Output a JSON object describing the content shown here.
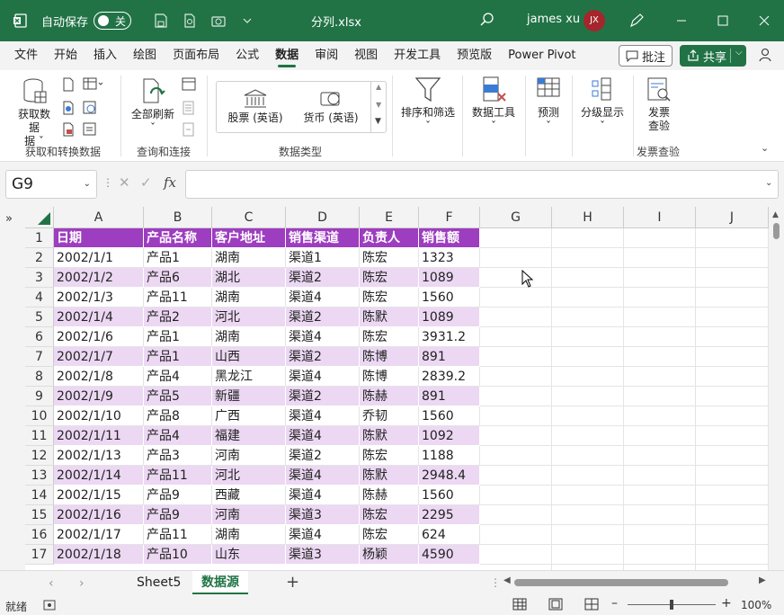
{
  "title_bar": {
    "autosave_label": "自动保存",
    "autosave_state": "关",
    "doc_title": "分列.xlsx",
    "user_name": "james xu",
    "user_initials": "JX"
  },
  "menu": {
    "items": [
      "文件",
      "开始",
      "插入",
      "绘图",
      "页面布局",
      "公式",
      "数据",
      "审阅",
      "视图",
      "开发工具",
      "预览版",
      "Power Pivot"
    ],
    "active": "数据",
    "comment_label": "批注",
    "share_label": "共享"
  },
  "ribbon": {
    "get_data": "获取数据",
    "get_data_sub": "据",
    "group_get": "获取和转换数据",
    "refresh_all": "全部刷新",
    "group_query": "查询和连接",
    "stocks": "股票 (英语)",
    "currency": "货币 (英语)",
    "group_types": "数据类型",
    "sort_filter": "排序和筛选",
    "data_tools": "数据工具",
    "forecast": "预测",
    "outline": "分级显示",
    "invoice_check": "发票",
    "invoice_check_2": "查验",
    "group_invoice": "发票查验"
  },
  "formula_bar": {
    "name_box": "G9",
    "fx": "fx",
    "formula": ""
  },
  "sheet": {
    "columns": [
      "A",
      "B",
      "C",
      "D",
      "E",
      "F",
      "G",
      "H",
      "I",
      "J"
    ],
    "row_numbers": [
      "1",
      "2",
      "3",
      "4",
      "5",
      "6",
      "7",
      "8",
      "9",
      "10",
      "11",
      "12",
      "13",
      "14",
      "15",
      "16",
      "17"
    ],
    "header": [
      "日期",
      "产品名称",
      "客户地址",
      "销售渠道",
      "负责人",
      "销售额"
    ],
    "rows": [
      [
        "2002/1/1",
        "产品1",
        "湖南",
        "渠道1",
        "陈宏",
        "1323"
      ],
      [
        "2002/1/2",
        "产品6",
        "湖北",
        "渠道2",
        "陈宏",
        "1089"
      ],
      [
        "2002/1/3",
        "产品11",
        "湖南",
        "渠道4",
        "陈宏",
        "1560"
      ],
      [
        "2002/1/4",
        "产品2",
        "河北",
        "渠道2",
        "陈默",
        "1089"
      ],
      [
        "2002/1/6",
        "产品1",
        "湖南",
        "渠道4",
        "陈宏",
        "3931.2"
      ],
      [
        "2002/1/7",
        "产品1",
        "山西",
        "渠道2",
        "陈博",
        "891"
      ],
      [
        "2002/1/8",
        "产品4",
        "黑龙江",
        "渠道4",
        "陈博",
        "2839.2"
      ],
      [
        "2002/1/9",
        "产品5",
        "新疆",
        "渠道2",
        "陈赫",
        "891"
      ],
      [
        "2002/1/10",
        "产品8",
        "广西",
        "渠道4",
        "乔韧",
        "1560"
      ],
      [
        "2002/1/11",
        "产品4",
        "福建",
        "渠道4",
        "陈默",
        "1092"
      ],
      [
        "2002/1/13",
        "产品3",
        "河南",
        "渠道2",
        "陈宏",
        "1188"
      ],
      [
        "2002/1/14",
        "产品11",
        "河北",
        "渠道4",
        "陈默",
        "2948.4"
      ],
      [
        "2002/1/15",
        "产品9",
        "西藏",
        "渠道4",
        "陈赫",
        "1560"
      ],
      [
        "2002/1/16",
        "产品9",
        "河南",
        "渠道3",
        "陈宏",
        "2295"
      ],
      [
        "2002/1/17",
        "产品11",
        "湖南",
        "渠道4",
        "陈宏",
        "624"
      ],
      [
        "2002/1/18",
        "产品10",
        "山东",
        "渠道3",
        "杨颖",
        "4590"
      ]
    ],
    "header_color": "#9d3dbf",
    "band_color": "#ecd8f3"
  },
  "tabs": {
    "sheets": [
      "Sheet5",
      "数据源"
    ],
    "active": "数据源"
  },
  "status": {
    "ready": "就绪",
    "zoom": "100%"
  },
  "colors": {
    "brand": "#217346"
  }
}
